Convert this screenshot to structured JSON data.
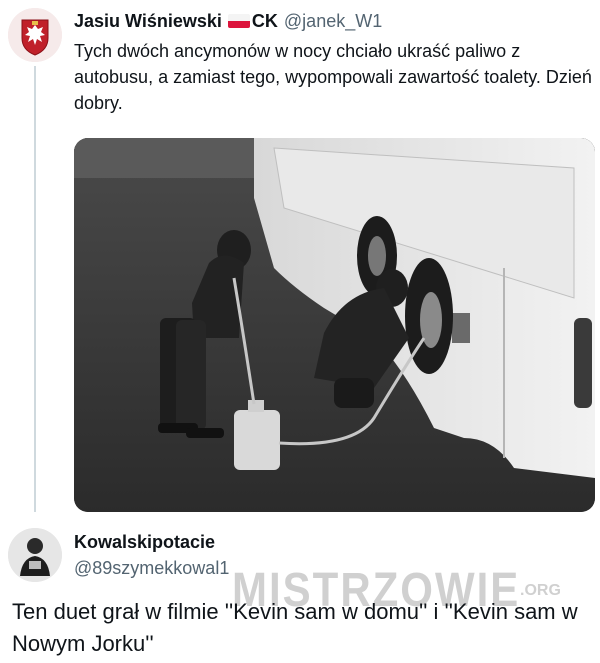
{
  "tweet": {
    "author_name": "Jasiu Wiśniewski",
    "author_suffix": "CK",
    "handle": "@janek_W1",
    "text": "Tych dwóch ancymonów w nocy chciało ukraść paliwo z autobusu, a zamiast tego, wypompowali zawartość toalety. Dzień dobry.",
    "avatar_icon": "polish-eagle-emblem",
    "flag_icon": "poland-flag"
  },
  "reply": {
    "author_name": "Kowalskipotacie",
    "handle": "@89szymekkowal1",
    "text": "Ten duet grał w filmie ''Kevin sam w domu'' i ''Kevin sam w Nowym Jorku''",
    "avatar_icon": "user-avatar-photo"
  },
  "watermark": {
    "text": "MISTRZOWIE",
    "suffix": ".ORG"
  },
  "colors": {
    "text": "#0f1419",
    "secondary": "#536471",
    "thread_line": "#cfd9de"
  }
}
